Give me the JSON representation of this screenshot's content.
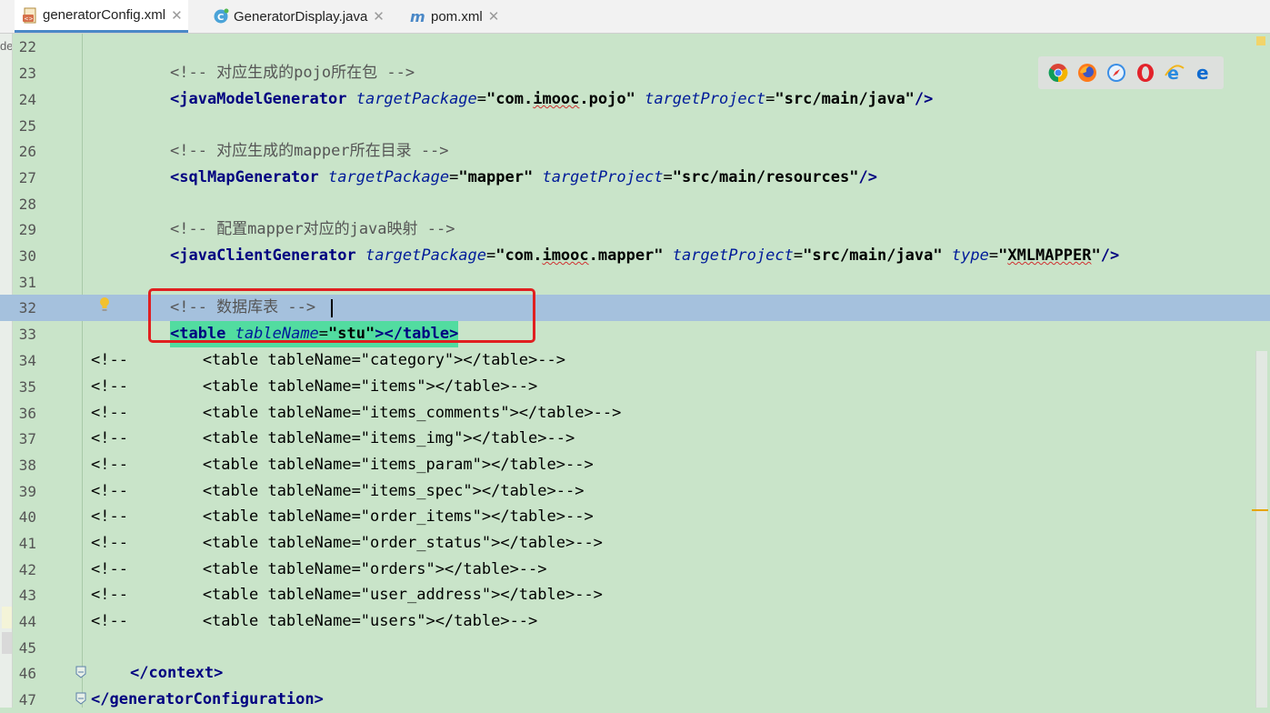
{
  "tabs": [
    {
      "label": "generatorConfig.xml",
      "icon": "xml-file-icon",
      "active": true
    },
    {
      "label": "GeneratorDisplay.java",
      "icon": "java-class-icon",
      "active": false
    },
    {
      "label": "pom.xml",
      "icon": "maven-icon",
      "active": false
    }
  ],
  "left_panel_label": "de",
  "browser_icons": [
    "chrome-icon",
    "firefox-icon",
    "safari-icon",
    "opera-icon",
    "ie-icon",
    "edge-icon"
  ],
  "colors": {
    "background": "#c9e4c9",
    "current_line": "#a5c1dd",
    "highlight": "#52dca0",
    "annotation_box": "#e02020"
  },
  "editor": {
    "current_line": 32,
    "lines": [
      {
        "n": "22",
        "t": ""
      },
      {
        "n": "23",
        "t": "<!-- 对应生成的pojo所在包 -->"
      },
      {
        "n": "24",
        "t": "<javaModelGenerator targetPackage=\"com.imooc.pojo\" targetProject=\"src/main/java\"/>"
      },
      {
        "n": "25",
        "t": ""
      },
      {
        "n": "26",
        "t": "<!-- 对应生成的mapper所在目录 -->"
      },
      {
        "n": "27",
        "t": "<sqlMapGenerator targetPackage=\"mapper\" targetProject=\"src/main/resources\"/>"
      },
      {
        "n": "28",
        "t": ""
      },
      {
        "n": "29",
        "t": "<!-- 配置mapper对应的java映射 -->"
      },
      {
        "n": "30",
        "t": "<javaClientGenerator targetPackage=\"com.imooc.mapper\" targetProject=\"src/main/java\" type=\"XMLMAPPER\"/>"
      },
      {
        "n": "31",
        "t": ""
      },
      {
        "n": "32",
        "t": "<!-- 数据库表 -->"
      },
      {
        "n": "33",
        "t": "<table tableName=\"stu\"></table>"
      },
      {
        "n": "34",
        "t": "<!--        <table tableName=\"category\"></table>-->"
      },
      {
        "n": "35",
        "t": "<!--        <table tableName=\"items\"></table>-->"
      },
      {
        "n": "36",
        "t": "<!--        <table tableName=\"items_comments\"></table>-->"
      },
      {
        "n": "37",
        "t": "<!--        <table tableName=\"items_img\"></table>-->"
      },
      {
        "n": "38",
        "t": "<!--        <table tableName=\"items_param\"></table>-->"
      },
      {
        "n": "39",
        "t": "<!--        <table tableName=\"items_spec\"></table>-->"
      },
      {
        "n": "40",
        "t": "<!--        <table tableName=\"order_items\"></table>-->"
      },
      {
        "n": "41",
        "t": "<!--        <table tableName=\"order_status\"></table>-->"
      },
      {
        "n": "42",
        "t": "<!--        <table tableName=\"orders\"></table>-->"
      },
      {
        "n": "43",
        "t": "<!--        <table tableName=\"user_address\"></table>-->"
      },
      {
        "n": "44",
        "t": "<!--        <table tableName=\"users\"></table>-->"
      },
      {
        "n": "45",
        "t": ""
      },
      {
        "n": "46",
        "t": "</context>"
      },
      {
        "n": "47",
        "t": "</generatorConfiguration>"
      }
    ]
  }
}
